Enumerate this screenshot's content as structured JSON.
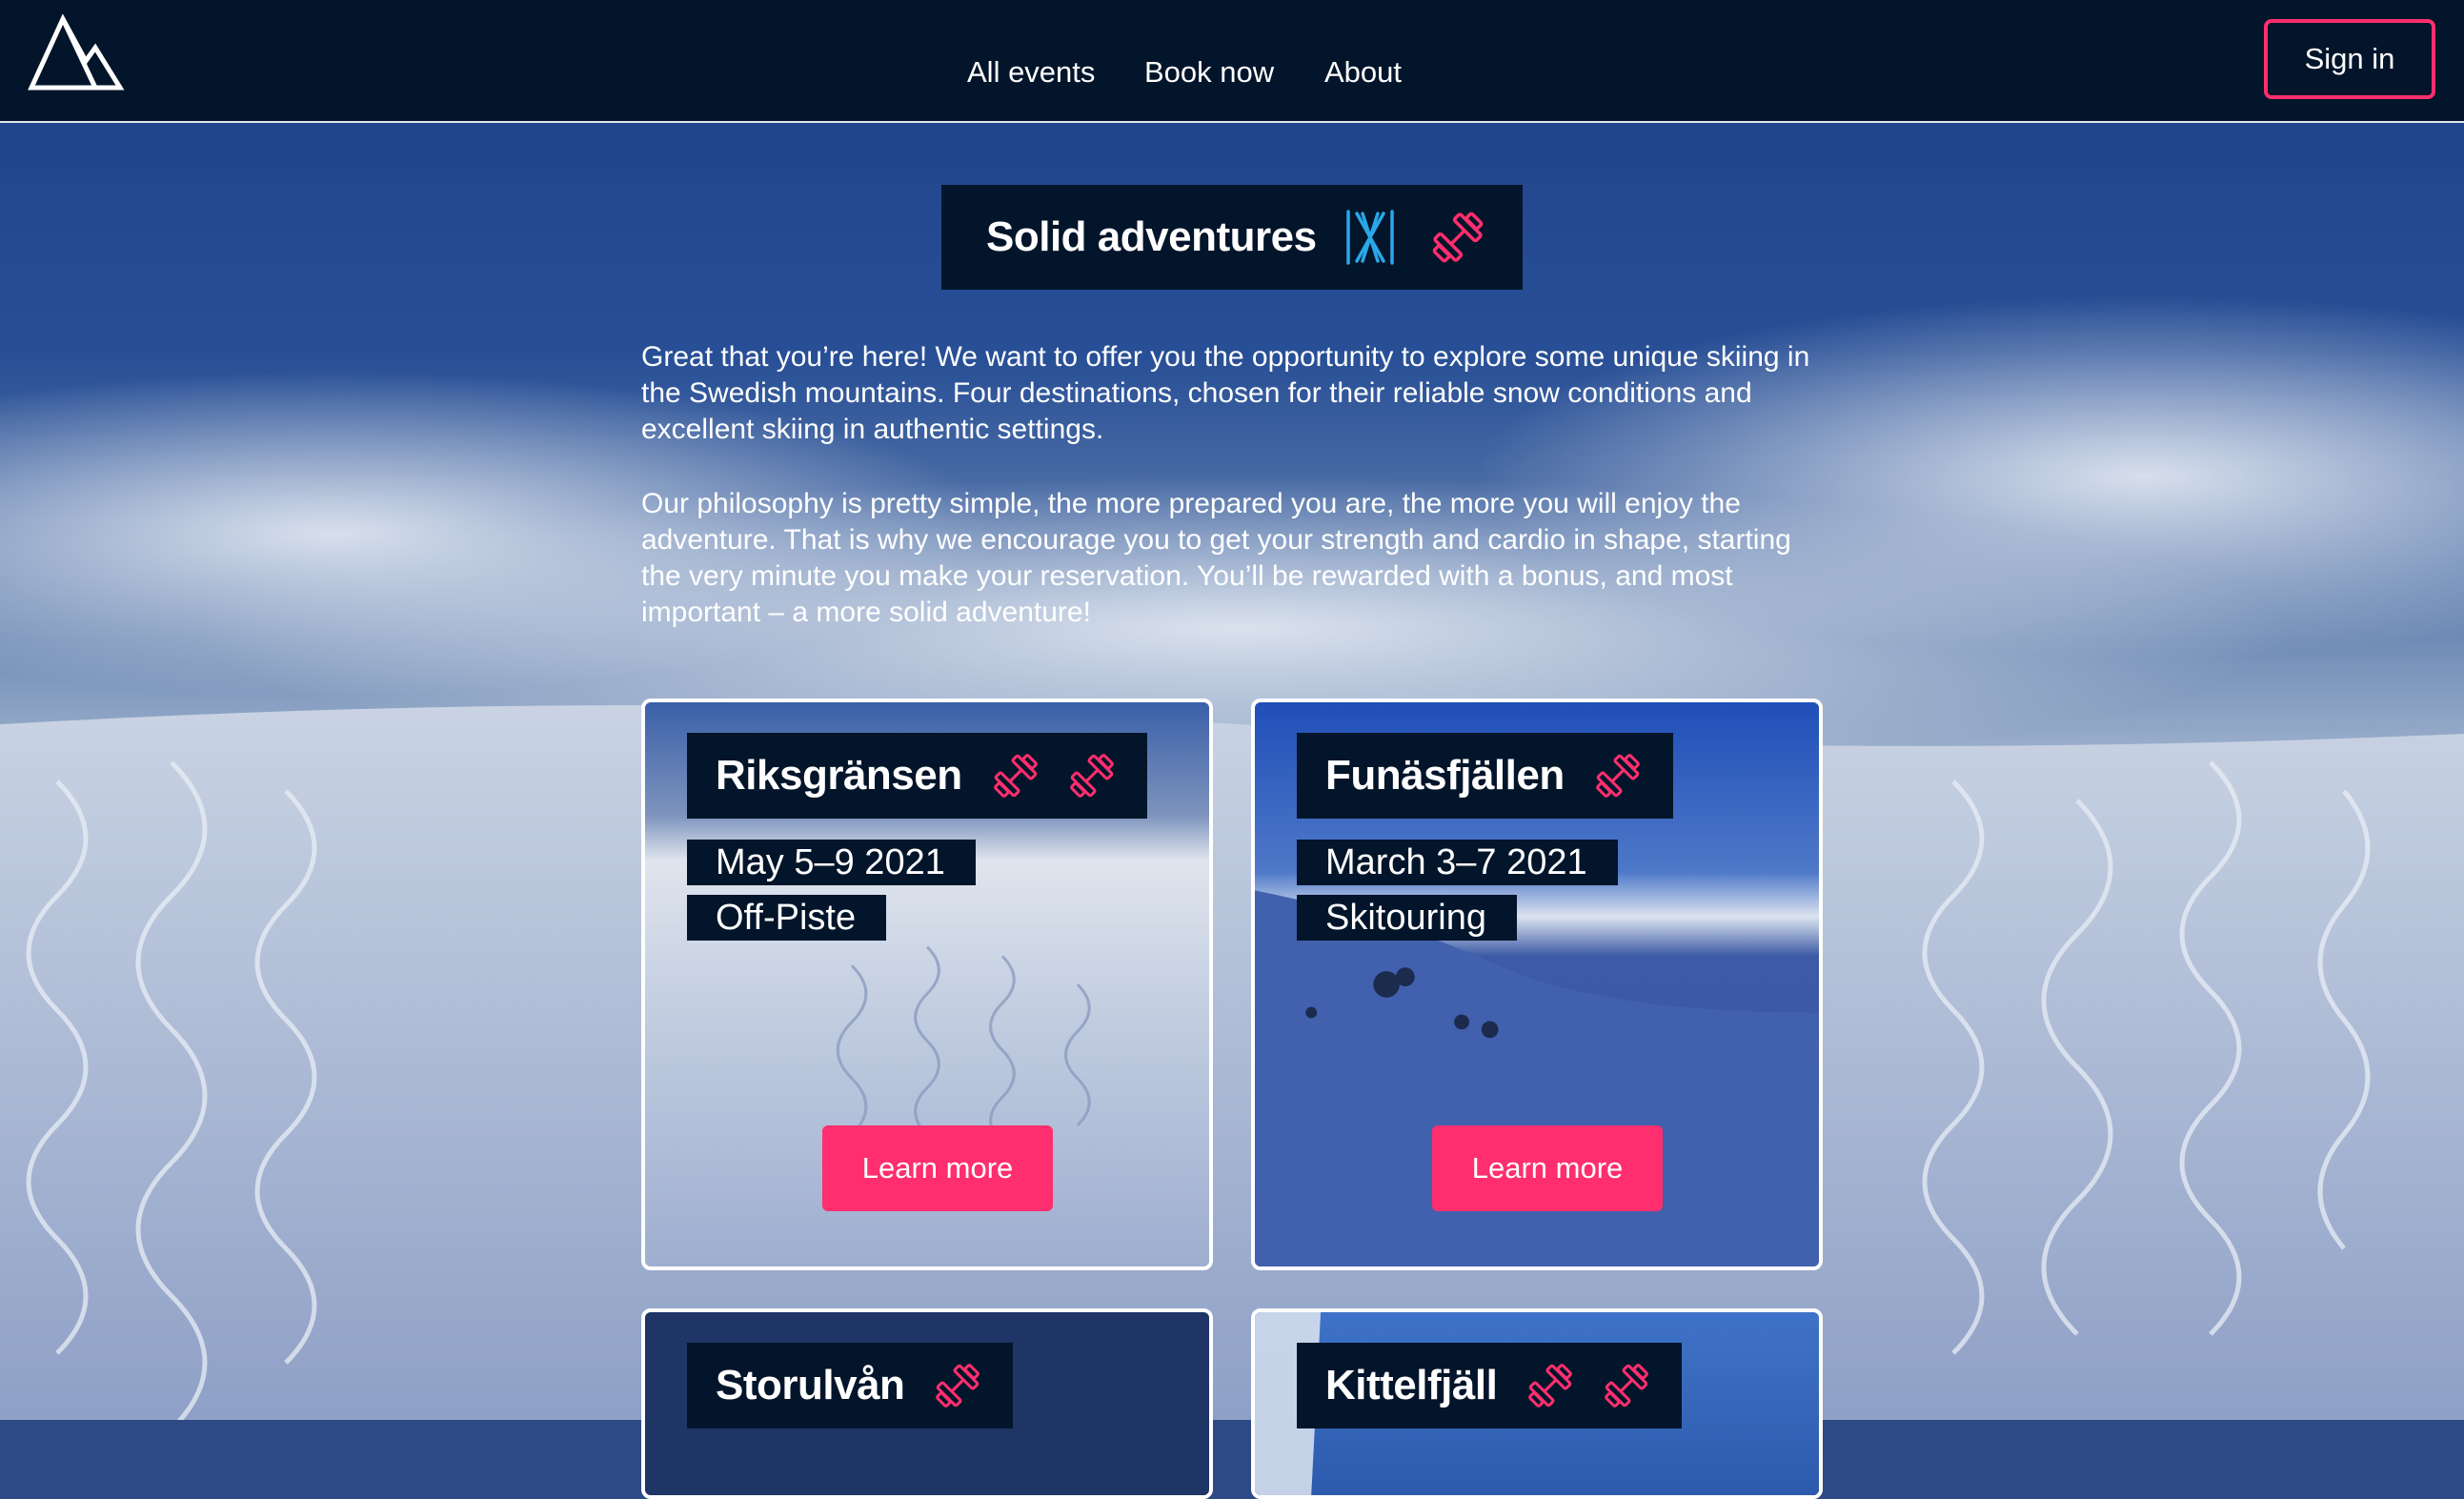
{
  "header": {
    "logo": "mountain-logo-icon",
    "nav": [
      {
        "label": "All events"
      },
      {
        "label": "Book now"
      },
      {
        "label": "About"
      }
    ],
    "signin_label": "Sign in"
  },
  "hero": {
    "title": "Solid adventures",
    "title_icons": [
      "skis-icon",
      "dumbbell-icon"
    ]
  },
  "intro": {
    "paragraphs": [
      "Great that you’re here! We want to offer you the opportunity to explore some unique skiing in the Swedish mountains. Four destinations, chosen for their reliable snow conditions and excellent skiing in authentic settings.",
      "Our philosophy is pretty simple, the more prepared you are, the more you will enjoy the adventure. That is why we encourage you to get your strength and cardio in shape, starting the very minute you make your reservation. You’ll be rewarded with a bonus, and most important – a more solid adventure!"
    ]
  },
  "cards": [
    {
      "title": "Riksgränsen",
      "date": "May 5–9 2021",
      "type": "Off-Piste",
      "difficulty": 2,
      "button": "Learn more"
    },
    {
      "title": "Funäsfjällen",
      "date": "March 3–7 2021",
      "type": "Skitouring",
      "difficulty": 1,
      "button": "Learn more"
    },
    {
      "title": "Storulvån",
      "difficulty": 1
    },
    {
      "title": "Kittelfjäll",
      "difficulty": 2
    }
  ],
  "colors": {
    "accent": "#ff2e6e",
    "navy": "#03152a",
    "ski_blue": "#2aa7e8"
  }
}
